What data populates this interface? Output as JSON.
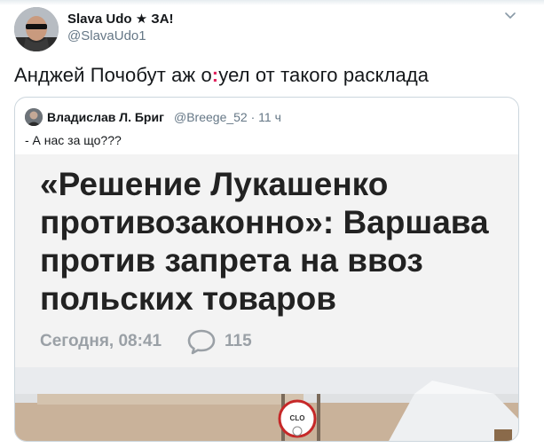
{
  "tweet": {
    "author_name": "Slava Udo ★ ЗА!",
    "author_handle": "@SlavaUdo1",
    "text_before": "Анджей Почобут аж о",
    "text_middle": ":",
    "text_after": "уел от такого расклада"
  },
  "quoted_tweet": {
    "author_name": "Владислав Л. Бриг",
    "author_handle": "@Breege_52 · 11 ч",
    "text": "- А нас за що???",
    "image": {
      "headline_lines": [
        "«Решение Лукашенко",
        "противозаконно»: Варшава",
        "против запрета на ввоз",
        "польских товаров"
      ],
      "date": "Сегодня, 08:41",
      "comment_count": "115",
      "sign_text": "CLO"
    }
  },
  "icons": {
    "caret": "chevron-down-icon",
    "comment": "comment-bubble-icon"
  }
}
